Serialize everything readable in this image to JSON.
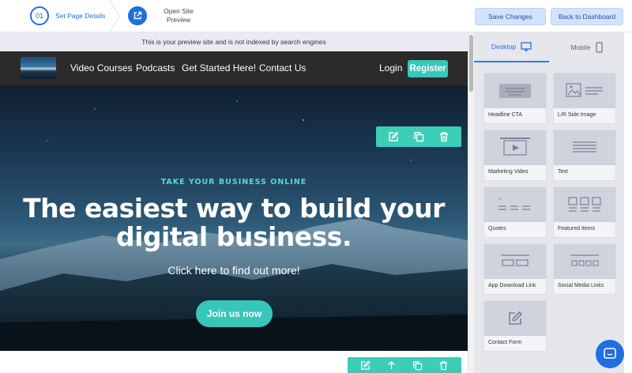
{
  "topbar": {
    "step1_number": "01",
    "step1_label": "Set Page Details",
    "step2_label": "Open Site Preview",
    "save_label": "Save Changes",
    "back_label": "Back to Dashboard"
  },
  "notice": "This is your preview site and is not indexed by search engines",
  "site": {
    "nav": [
      "Video Courses",
      "Podcasts",
      "Get Started Here!",
      "Contact Us"
    ],
    "login": "Login",
    "register": "Register",
    "eyebrow": "TAKE YOUR BUSINESS ONLINE",
    "headline_line1": "The easiest way to build your",
    "headline_line2": "digital business.",
    "subtitle": "Click here to find out more!",
    "cta": "Join us now"
  },
  "panel": {
    "tab_desktop": "Desktop",
    "tab_mobile": "Mobile",
    "blocks": [
      {
        "label": "Headline CTA",
        "icon": "headline-cta-icon"
      },
      {
        "label": "L/R Side Image",
        "icon": "side-image-icon"
      },
      {
        "label": "Marketing Video",
        "icon": "video-icon"
      },
      {
        "label": "Text",
        "icon": "text-icon"
      },
      {
        "label": "Quotes",
        "icon": "quotes-icon"
      },
      {
        "label": "Featured Items",
        "icon": "featured-items-icon"
      },
      {
        "label": "App Download Link",
        "icon": "app-download-icon"
      },
      {
        "label": "Social Media Links",
        "icon": "social-links-icon"
      },
      {
        "label": "Contact Form",
        "icon": "contact-form-icon"
      }
    ]
  },
  "colors": {
    "accent": "#1f6fe0",
    "teal": "#38c6bb",
    "nav_bg": "#2b2b2c",
    "panel_bg": "#e6e7ec"
  }
}
